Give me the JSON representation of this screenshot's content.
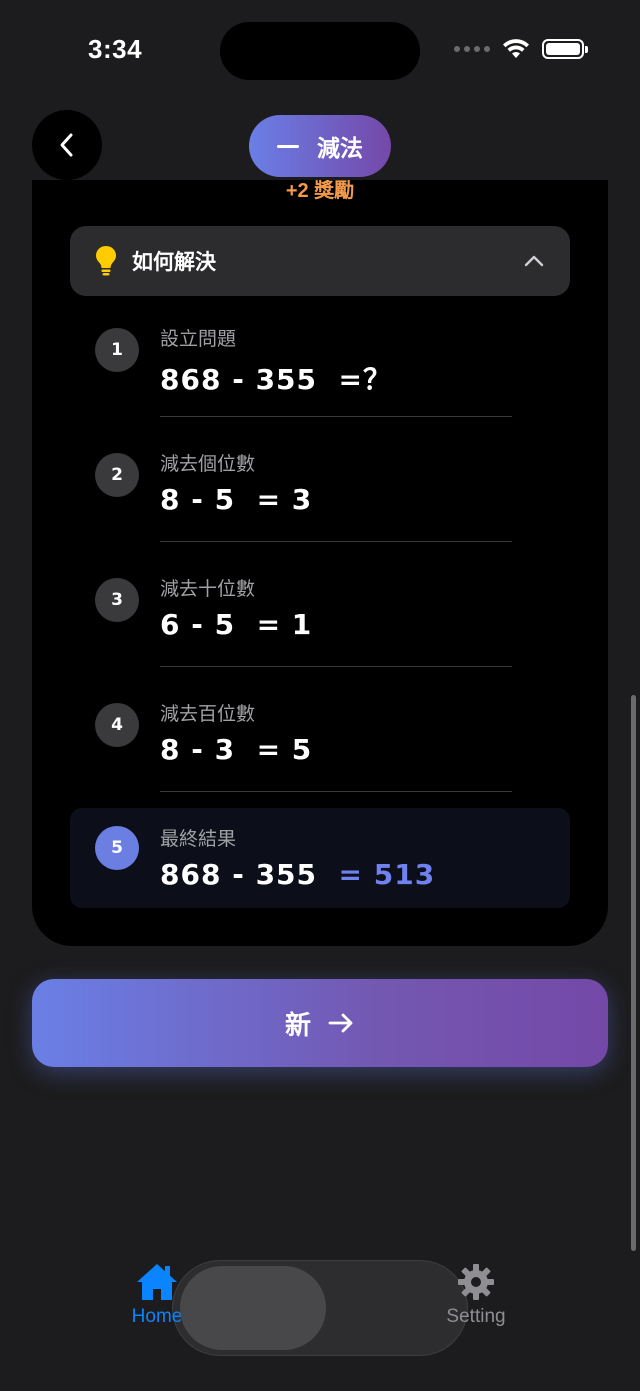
{
  "status_bar": {
    "time": "3:34"
  },
  "top": {
    "mode_label": "減法"
  },
  "card": {
    "bonus": "+2 獎勵",
    "header_title": "如何解決",
    "steps": [
      {
        "num": "1",
        "title": "設立問題",
        "expr": "868 - 355",
        "result": "=？"
      },
      {
        "num": "2",
        "title": "減去個位數",
        "expr": "8 - 5",
        "result": "= 3"
      },
      {
        "num": "3",
        "title": "減去十位數",
        "expr": "6 - 5",
        "result": "= 1"
      },
      {
        "num": "4",
        "title": "減去百位數",
        "expr": "8 - 3",
        "result": "= 5"
      }
    ],
    "final": {
      "num": "5",
      "title": "最終結果",
      "expr": "868 - 355",
      "result": "= 513"
    }
  },
  "new_button": {
    "label": "新"
  },
  "tabbar": {
    "home_label": "Home",
    "setting_label": "Setting"
  },
  "colors": {
    "accent": "#6f82f0",
    "tab_active": "#0a84ff",
    "tab_inactive": "#8e8e93",
    "bonus": "#f2994a"
  },
  "icons": [
    "chevron-left-icon",
    "minus-icon",
    "bulb-icon",
    "chevron-up-icon",
    "arrow-right-icon",
    "home-icon",
    "gear-icon",
    "wifi-icon",
    "battery-icon"
  ]
}
